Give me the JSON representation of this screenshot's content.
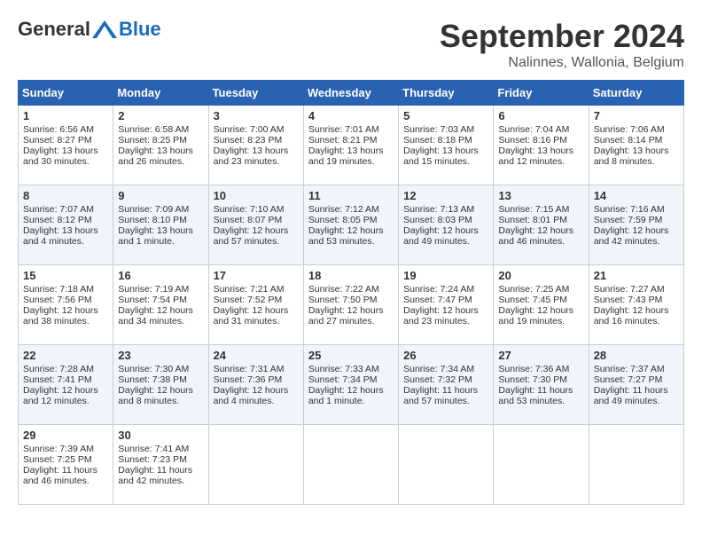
{
  "logo": {
    "general": "General",
    "blue": "Blue"
  },
  "calendar": {
    "title": "September 2024",
    "subtitle": "Nalinnes, Wallonia, Belgium"
  },
  "weekdays": [
    "Sunday",
    "Monday",
    "Tuesday",
    "Wednesday",
    "Thursday",
    "Friday",
    "Saturday"
  ],
  "weeks": [
    [
      {
        "day": 1,
        "lines": [
          "Sunrise: 6:56 AM",
          "Sunset: 8:27 PM",
          "Daylight: 13 hours",
          "and 30 minutes."
        ]
      },
      {
        "day": 2,
        "lines": [
          "Sunrise: 6:58 AM",
          "Sunset: 8:25 PM",
          "Daylight: 13 hours",
          "and 26 minutes."
        ]
      },
      {
        "day": 3,
        "lines": [
          "Sunrise: 7:00 AM",
          "Sunset: 8:23 PM",
          "Daylight: 13 hours",
          "and 23 minutes."
        ]
      },
      {
        "day": 4,
        "lines": [
          "Sunrise: 7:01 AM",
          "Sunset: 8:21 PM",
          "Daylight: 13 hours",
          "and 19 minutes."
        ]
      },
      {
        "day": 5,
        "lines": [
          "Sunrise: 7:03 AM",
          "Sunset: 8:18 PM",
          "Daylight: 13 hours",
          "and 15 minutes."
        ]
      },
      {
        "day": 6,
        "lines": [
          "Sunrise: 7:04 AM",
          "Sunset: 8:16 PM",
          "Daylight: 13 hours",
          "and 12 minutes."
        ]
      },
      {
        "day": 7,
        "lines": [
          "Sunrise: 7:06 AM",
          "Sunset: 8:14 PM",
          "Daylight: 13 hours",
          "and 8 minutes."
        ]
      }
    ],
    [
      {
        "day": 8,
        "lines": [
          "Sunrise: 7:07 AM",
          "Sunset: 8:12 PM",
          "Daylight: 13 hours",
          "and 4 minutes."
        ]
      },
      {
        "day": 9,
        "lines": [
          "Sunrise: 7:09 AM",
          "Sunset: 8:10 PM",
          "Daylight: 13 hours",
          "and 1 minute."
        ]
      },
      {
        "day": 10,
        "lines": [
          "Sunrise: 7:10 AM",
          "Sunset: 8:07 PM",
          "Daylight: 12 hours",
          "and 57 minutes."
        ]
      },
      {
        "day": 11,
        "lines": [
          "Sunrise: 7:12 AM",
          "Sunset: 8:05 PM",
          "Daylight: 12 hours",
          "and 53 minutes."
        ]
      },
      {
        "day": 12,
        "lines": [
          "Sunrise: 7:13 AM",
          "Sunset: 8:03 PM",
          "Daylight: 12 hours",
          "and 49 minutes."
        ]
      },
      {
        "day": 13,
        "lines": [
          "Sunrise: 7:15 AM",
          "Sunset: 8:01 PM",
          "Daylight: 12 hours",
          "and 46 minutes."
        ]
      },
      {
        "day": 14,
        "lines": [
          "Sunrise: 7:16 AM",
          "Sunset: 7:59 PM",
          "Daylight: 12 hours",
          "and 42 minutes."
        ]
      }
    ],
    [
      {
        "day": 15,
        "lines": [
          "Sunrise: 7:18 AM",
          "Sunset: 7:56 PM",
          "Daylight: 12 hours",
          "and 38 minutes."
        ]
      },
      {
        "day": 16,
        "lines": [
          "Sunrise: 7:19 AM",
          "Sunset: 7:54 PM",
          "Daylight: 12 hours",
          "and 34 minutes."
        ]
      },
      {
        "day": 17,
        "lines": [
          "Sunrise: 7:21 AM",
          "Sunset: 7:52 PM",
          "Daylight: 12 hours",
          "and 31 minutes."
        ]
      },
      {
        "day": 18,
        "lines": [
          "Sunrise: 7:22 AM",
          "Sunset: 7:50 PM",
          "Daylight: 12 hours",
          "and 27 minutes."
        ]
      },
      {
        "day": 19,
        "lines": [
          "Sunrise: 7:24 AM",
          "Sunset: 7:47 PM",
          "Daylight: 12 hours",
          "and 23 minutes."
        ]
      },
      {
        "day": 20,
        "lines": [
          "Sunrise: 7:25 AM",
          "Sunset: 7:45 PM",
          "Daylight: 12 hours",
          "and 19 minutes."
        ]
      },
      {
        "day": 21,
        "lines": [
          "Sunrise: 7:27 AM",
          "Sunset: 7:43 PM",
          "Daylight: 12 hours",
          "and 16 minutes."
        ]
      }
    ],
    [
      {
        "day": 22,
        "lines": [
          "Sunrise: 7:28 AM",
          "Sunset: 7:41 PM",
          "Daylight: 12 hours",
          "and 12 minutes."
        ]
      },
      {
        "day": 23,
        "lines": [
          "Sunrise: 7:30 AM",
          "Sunset: 7:38 PM",
          "Daylight: 12 hours",
          "and 8 minutes."
        ]
      },
      {
        "day": 24,
        "lines": [
          "Sunrise: 7:31 AM",
          "Sunset: 7:36 PM",
          "Daylight: 12 hours",
          "and 4 minutes."
        ]
      },
      {
        "day": 25,
        "lines": [
          "Sunrise: 7:33 AM",
          "Sunset: 7:34 PM",
          "Daylight: 12 hours",
          "and 1 minute."
        ]
      },
      {
        "day": 26,
        "lines": [
          "Sunrise: 7:34 AM",
          "Sunset: 7:32 PM",
          "Daylight: 11 hours",
          "and 57 minutes."
        ]
      },
      {
        "day": 27,
        "lines": [
          "Sunrise: 7:36 AM",
          "Sunset: 7:30 PM",
          "Daylight: 11 hours",
          "and 53 minutes."
        ]
      },
      {
        "day": 28,
        "lines": [
          "Sunrise: 7:37 AM",
          "Sunset: 7:27 PM",
          "Daylight: 11 hours",
          "and 49 minutes."
        ]
      }
    ],
    [
      {
        "day": 29,
        "lines": [
          "Sunrise: 7:39 AM",
          "Sunset: 7:25 PM",
          "Daylight: 11 hours",
          "and 46 minutes."
        ]
      },
      {
        "day": 30,
        "lines": [
          "Sunrise: 7:41 AM",
          "Sunset: 7:23 PM",
          "Daylight: 11 hours",
          "and 42 minutes."
        ]
      },
      null,
      null,
      null,
      null,
      null
    ]
  ]
}
